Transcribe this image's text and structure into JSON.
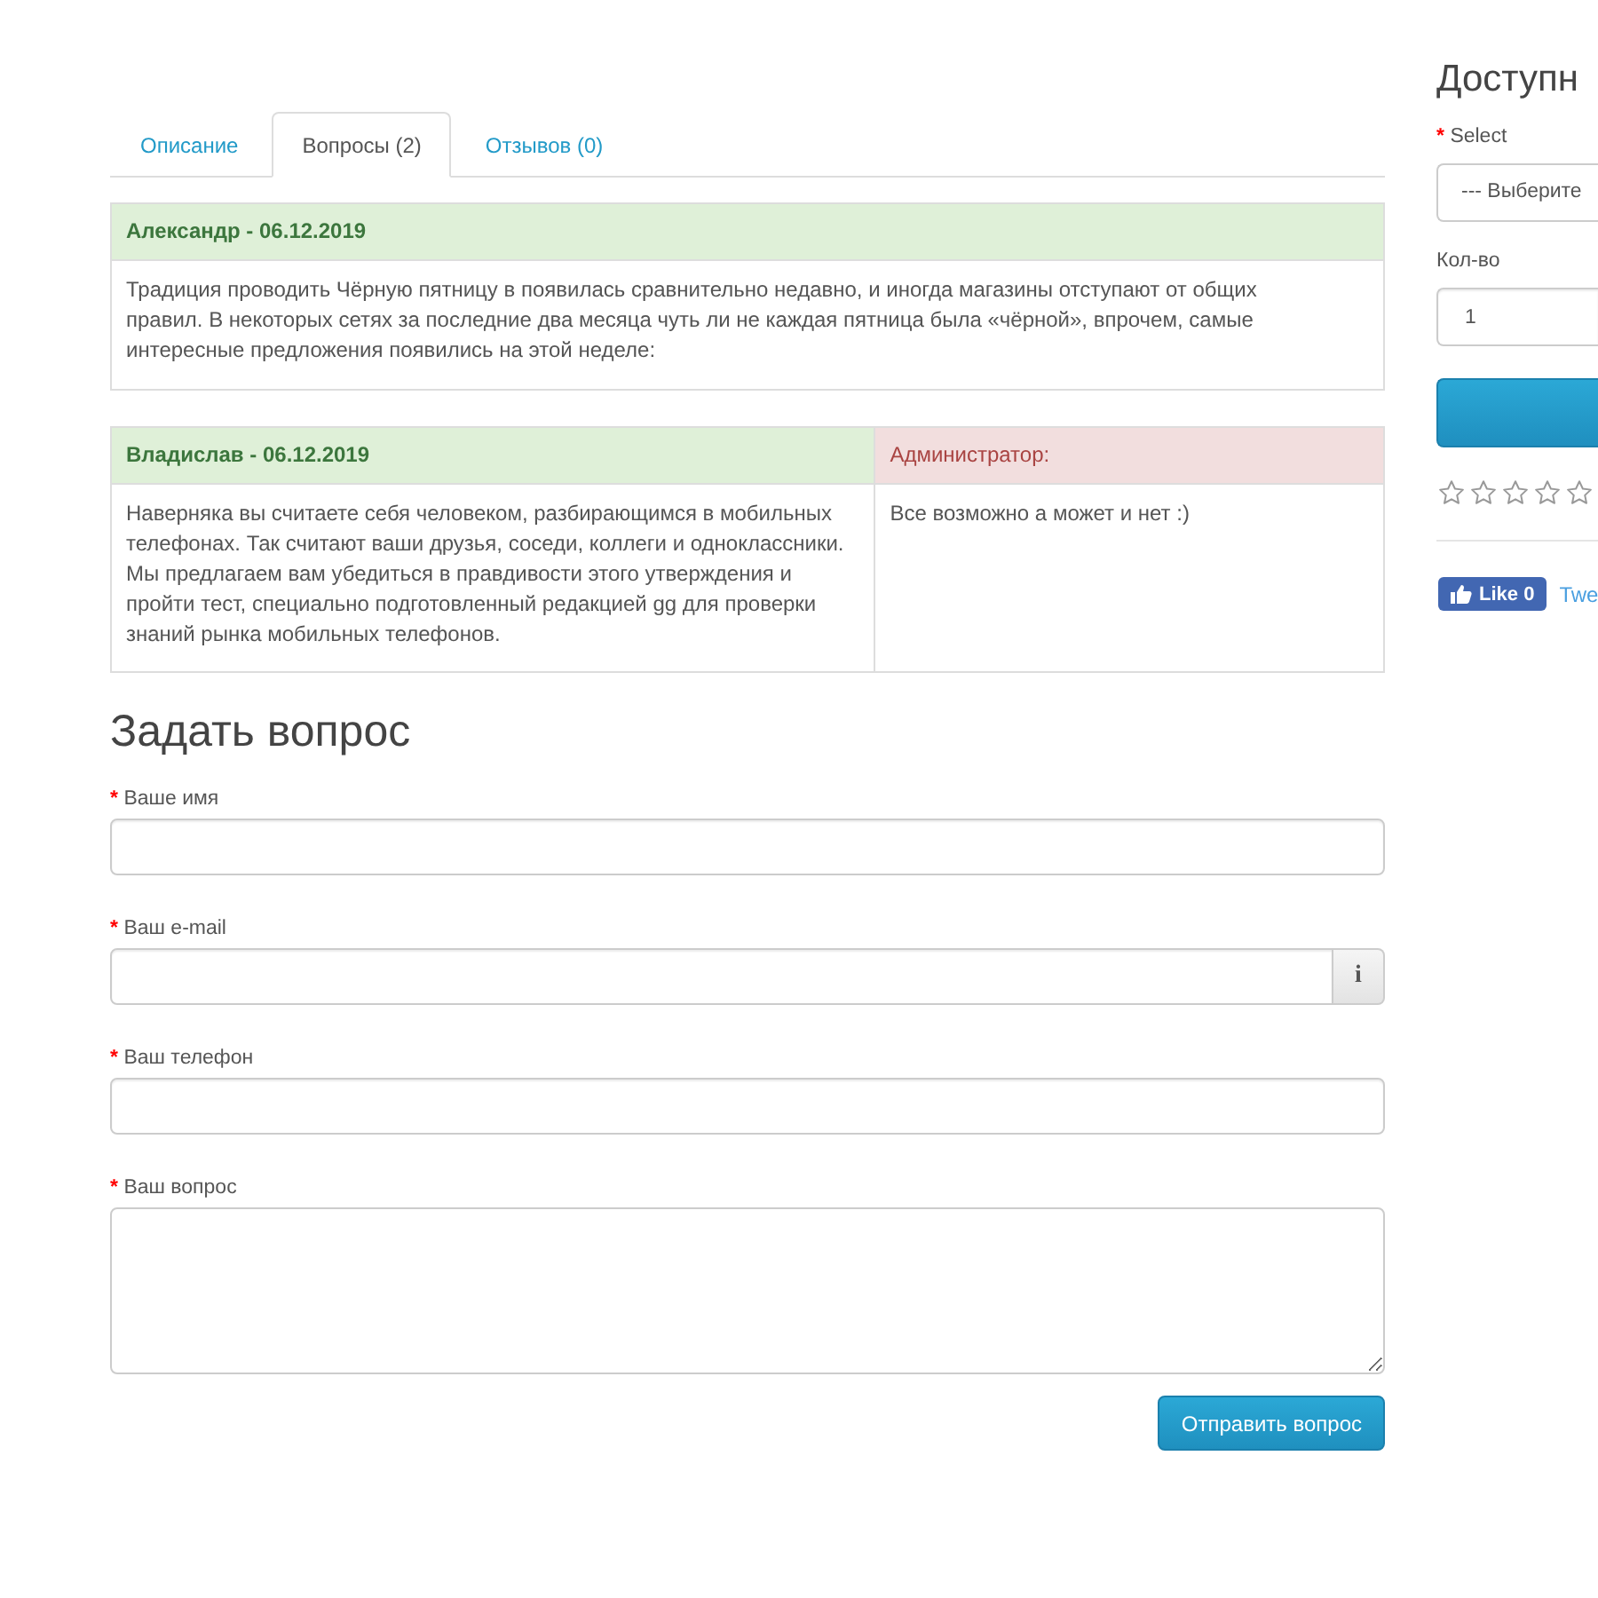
{
  "tabs": [
    {
      "label": "Описание",
      "selected": false
    },
    {
      "label": "Вопросы (2)",
      "selected": true
    },
    {
      "label": "Отзывов (0)",
      "selected": false
    }
  ],
  "questions": [
    {
      "author": "Александр - 06.12.2019",
      "text": "Традиция проводить Чёрную пятницу в появилась сравнительно недавно, и иногда магазины отступают от общих правил. В некоторых сетях за последние два месяца чуть ли не каждая пятница была «чёрной», впрочем, самые интересные предложения появились на этой неделе:"
    },
    {
      "author": "Владислав - 06.12.2019",
      "text": "Наверняка вы считаете себя человеком, разбирающимся в мобильных телефонах. Так считают ваши друзья, соседи, коллеги и одноклассники. Мы предлагаем вам убедиться в правдивости этого утверждения и пройти тест, специально подготовленный редакцией gg для проверки знаний рынка мобильных телефонов.",
      "answer": {
        "label": "Администратор:",
        "text": "Все возможно а может и нет :)"
      }
    }
  ],
  "form": {
    "title": "Задать вопрос",
    "fields": [
      {
        "kind": "text",
        "required_mark": "*",
        "label": "Ваше имя"
      },
      {
        "kind": "text_info",
        "required_mark": "*",
        "label": "Ваш e-mail",
        "addon": "i"
      },
      {
        "kind": "text",
        "required_mark": "*",
        "label": "Ваш телефон"
      },
      {
        "kind": "textarea",
        "required_mark": "*",
        "label": "Ваш вопрос"
      }
    ],
    "submit": "Отправить вопрос"
  },
  "sidebar": {
    "heading": "Доступн",
    "options": [
      {
        "kind": "select",
        "required_mark": "*",
        "label": "Select",
        "value": "--- Выберите"
      },
      {
        "kind": "input",
        "label": "Кол-во",
        "value": "1"
      }
    ],
    "action_button": {
      "kind": "primary"
    },
    "rating": {
      "stars": 0
    },
    "social": {
      "like": "Like 0",
      "tweet": "Twe"
    }
  }
}
